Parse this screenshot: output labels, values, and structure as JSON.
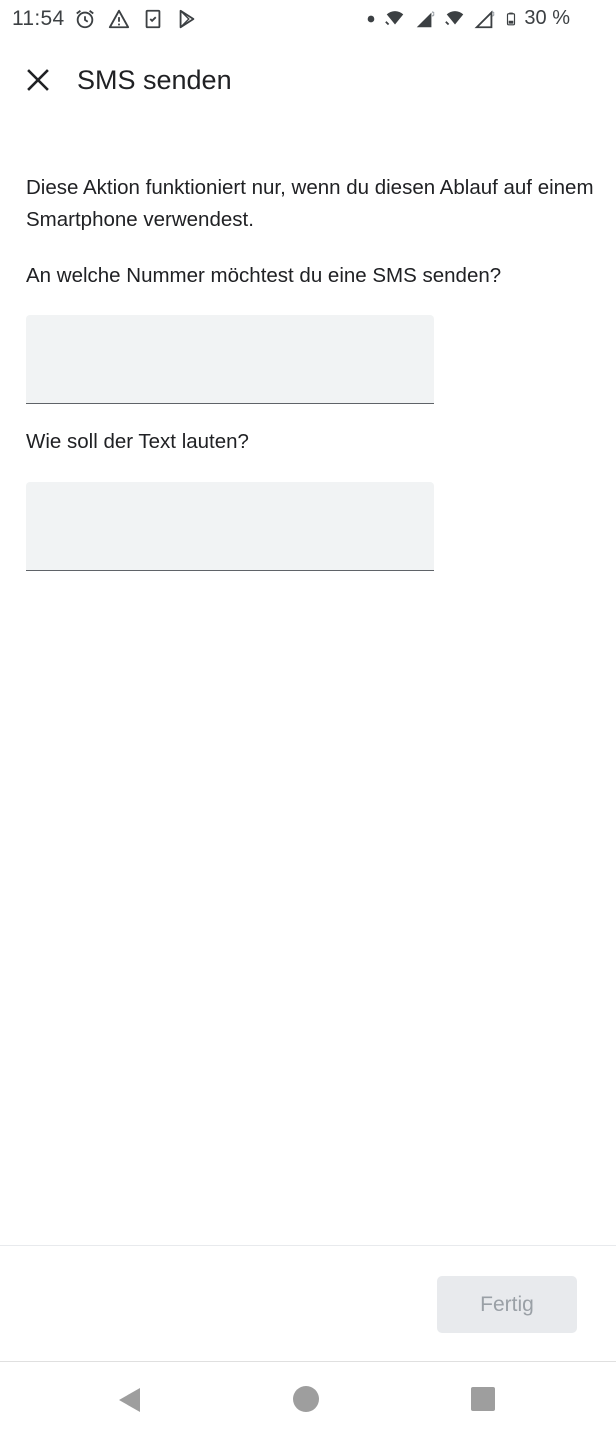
{
  "status_bar": {
    "time": "11:54",
    "battery": "30 %",
    "icons_left": [
      "alarm-icon",
      "warning-icon",
      "clipboard-check-icon",
      "play-store-icon"
    ],
    "icons_right": [
      "dot-icon",
      "wifi-call-icon",
      "signal-icon",
      "wifi-call-icon",
      "signal-icon",
      "battery-icon"
    ]
  },
  "app_bar": {
    "title": "SMS senden",
    "close_icon": "close-icon"
  },
  "content": {
    "description": "Diese Aktion funktioniert nur, wenn du diesen Ablauf auf einem Smartphone verwendest.",
    "number_question": "An welche Nummer möchtest du eine SMS senden?",
    "number_value": "",
    "text_question": "Wie soll der Text lauten?",
    "text_value": ""
  },
  "actions": {
    "done_label": "Fertig"
  },
  "nav_bar": {
    "back_icon": "back-triangle-icon",
    "home_icon": "home-circle-icon",
    "recent_icon": "recent-square-icon"
  },
  "colors": {
    "field_bg": "#f1f3f4",
    "button_bg": "#e8eaed",
    "button_text": "#9aa0a6",
    "text": "#202124"
  }
}
